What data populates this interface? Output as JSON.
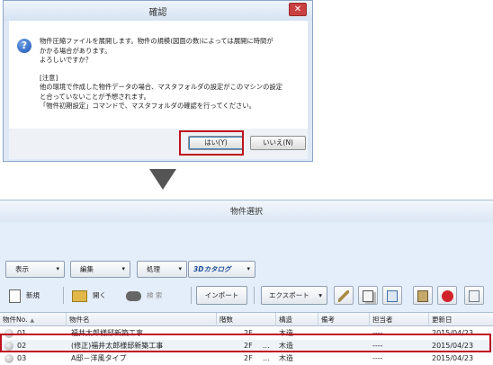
{
  "dialog": {
    "title": "確認",
    "close_glyph": "✕",
    "icon_glyph": "?",
    "message_lines": [
      "物件圧縮ファイルを展開します。物件の規模(図面の数)によっては展開に時間が",
      "かかる場合があります。",
      "よろしいですか？",
      "",
      "[注意]",
      "他の環境で作成した物件データの場合、マスタフォルダの設定がこのマシンの設定",
      "と合っていないことが予想されます。",
      "「物件初期設定」コマンドで、マスタフォルダの確認を行ってください。"
    ],
    "yes_label": "はい(Y)",
    "no_label": "いいえ(N)"
  },
  "window": {
    "title": "物件選択",
    "menu": {
      "display": "表示",
      "edit": "編集",
      "process": "処理",
      "catalog_logo": "3Dカタログ",
      "caret": "▾"
    },
    "toolbar": {
      "new": "新規",
      "open": "開く",
      "search": "検 索",
      "import": "インポート",
      "export": "エクスポート"
    },
    "columns": [
      "物件No.",
      "物件名",
      "階数",
      "構造",
      "備考",
      "担当者",
      "更新日"
    ],
    "sort_glyph": "▲",
    "rows": [
      {
        "no": "01",
        "name": "福井太郎様邸新築工事",
        "floors": "2F",
        "dots": "...",
        "structure": "木造",
        "notes": "",
        "staff": "----",
        "date": "2015/04/23"
      },
      {
        "no": "02",
        "name": "(修正)福井太郎様邸新築工事",
        "floors": "2F",
        "dots": "...",
        "structure": "木造",
        "notes": "",
        "staff": "----",
        "date": "2015/04/23"
      },
      {
        "no": "03",
        "name": "A邸－洋風タイプ",
        "floors": "2F",
        "dots": "...",
        "structure": "木造",
        "notes": "",
        "staff": "----",
        "date": "2015/04/23"
      }
    ]
  },
  "colors": {
    "highlight": "#c0101e",
    "dialog_bg": "#dfe9f5",
    "window_bg": "#e4eefa"
  }
}
